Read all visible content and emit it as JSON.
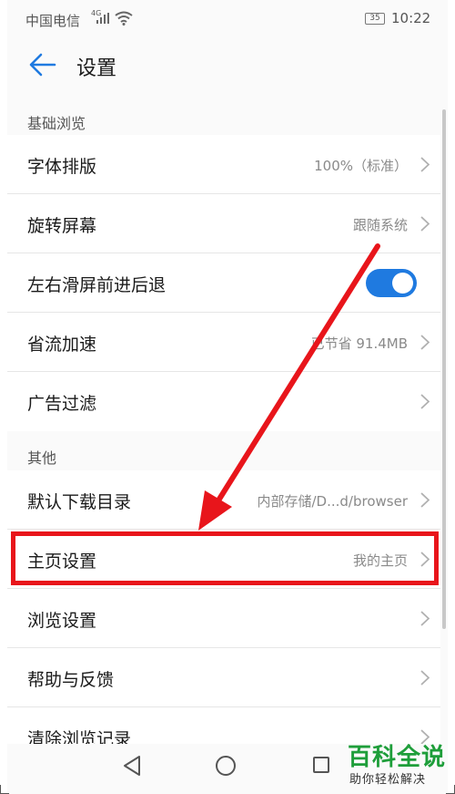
{
  "status_bar": {
    "carrier": "中国电信",
    "network": "4G",
    "battery": "35",
    "time": "10:22"
  },
  "header": {
    "title": "设置"
  },
  "sections": [
    {
      "title": "基础浏览",
      "items": [
        {
          "label": "字体排版",
          "value": "100%（标准）"
        },
        {
          "label": "旋转屏幕",
          "value": "跟随系统"
        },
        {
          "label": "左右滑屏前进后退",
          "value": "",
          "toggle": "on"
        },
        {
          "label": "省流加速",
          "value": "已节省 91.4MB"
        },
        {
          "label": "广告过滤",
          "value": ""
        }
      ]
    },
    {
      "title": "其他",
      "items": [
        {
          "label": "默认下载目录",
          "value": "内部存储/D...d/browser"
        },
        {
          "label": "主页设置",
          "value": "我的主页"
        },
        {
          "label": "浏览设置",
          "value": ""
        },
        {
          "label": "帮助与反馈",
          "value": ""
        },
        {
          "label": "清除浏览记录",
          "value": ""
        }
      ]
    }
  ],
  "watermark": {
    "title": "百科全说",
    "subtitle": "助你轻松解决"
  },
  "colors": {
    "accent": "#1f7ae0",
    "highlight": "#e8151b",
    "watermark": "#1e9e3a"
  },
  "icons": [
    "back-arrow-icon",
    "chevron-right-icon",
    "nav-back-icon",
    "nav-home-icon",
    "nav-recent-icon",
    "wifi-icon",
    "signal-icon",
    "battery-icon"
  ]
}
